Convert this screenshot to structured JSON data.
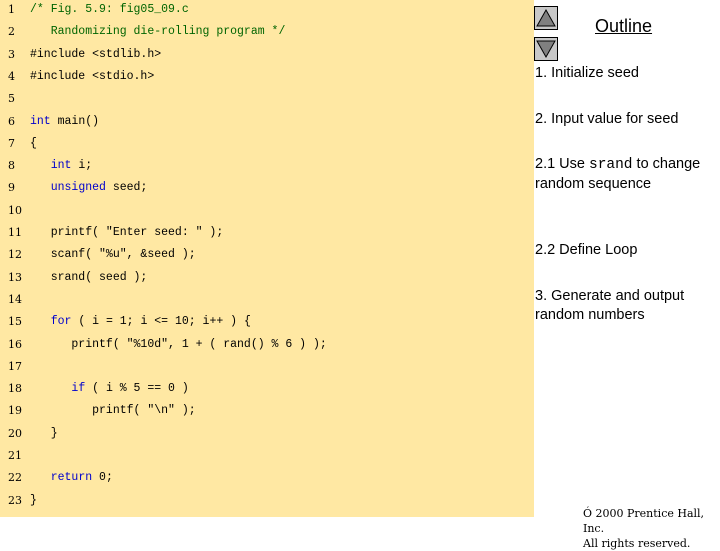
{
  "code_lines": [
    {
      "n": "1",
      "parts": [
        {
          "c": "cm",
          "t": "/* Fig. 5.9: fig05_09.c"
        }
      ]
    },
    {
      "n": "2",
      "parts": [
        {
          "c": "cm",
          "t": "   Randomizing die-rolling program */"
        }
      ]
    },
    {
      "n": "3",
      "parts": [
        {
          "c": "",
          "t": "#include <stdlib.h>"
        }
      ]
    },
    {
      "n": "4",
      "parts": [
        {
          "c": "",
          "t": "#include <stdio.h>"
        }
      ]
    },
    {
      "n": "5",
      "parts": []
    },
    {
      "n": "6",
      "parts": [
        {
          "c": "kw",
          "t": "int"
        },
        {
          "c": "",
          "t": " main()"
        }
      ]
    },
    {
      "n": "7",
      "parts": [
        {
          "c": "",
          "t": "{"
        }
      ]
    },
    {
      "n": "8",
      "parts": [
        {
          "c": "",
          "t": "   "
        },
        {
          "c": "kw",
          "t": "int"
        },
        {
          "c": "",
          "t": " i;"
        }
      ]
    },
    {
      "n": "9",
      "parts": [
        {
          "c": "",
          "t": "   "
        },
        {
          "c": "kw",
          "t": "unsigned"
        },
        {
          "c": "",
          "t": " seed;"
        }
      ]
    },
    {
      "n": "10",
      "parts": []
    },
    {
      "n": "11",
      "parts": [
        {
          "c": "",
          "t": "   printf( \"Enter seed: \" );"
        }
      ]
    },
    {
      "n": "12",
      "parts": [
        {
          "c": "",
          "t": "   scanf( \"%u\", &seed );"
        }
      ]
    },
    {
      "n": "13",
      "parts": [
        {
          "c": "",
          "t": "   srand( seed );"
        }
      ]
    },
    {
      "n": "14",
      "parts": []
    },
    {
      "n": "15",
      "parts": [
        {
          "c": "",
          "t": "   "
        },
        {
          "c": "kw",
          "t": "for"
        },
        {
          "c": "",
          "t": " ( i = 1; i <= 10; i++ ) {"
        }
      ]
    },
    {
      "n": "16",
      "parts": [
        {
          "c": "",
          "t": "      printf( \"%10d\", 1 + ( rand() % 6 ) );"
        }
      ]
    },
    {
      "n": "17",
      "parts": []
    },
    {
      "n": "18",
      "parts": [
        {
          "c": "",
          "t": "      "
        },
        {
          "c": "kw",
          "t": "if"
        },
        {
          "c": "",
          "t": " ( i % 5 == 0 )"
        }
      ]
    },
    {
      "n": "19",
      "parts": [
        {
          "c": "",
          "t": "         printf( \"\\n\" );"
        }
      ]
    },
    {
      "n": "20",
      "parts": [
        {
          "c": "",
          "t": "   }"
        }
      ]
    },
    {
      "n": "21",
      "parts": []
    },
    {
      "n": "22",
      "parts": [
        {
          "c": "",
          "t": "   "
        },
        {
          "c": "kw",
          "t": "return"
        },
        {
          "c": "",
          "t": " 0;"
        }
      ]
    },
    {
      "n": "23",
      "parts": [
        {
          "c": "",
          "t": "}"
        }
      ]
    }
  ],
  "outline": {
    "title": "Outline"
  },
  "nav": {
    "up_icon": "triangle-up-icon",
    "down_icon": "triangle-down-icon"
  },
  "steps": {
    "s1": "1.  Initialize seed",
    "s2": "2.  Input value for seed",
    "s21_prefix": "2.1  Use ",
    "s21_code": "srand",
    "s21_suffix": " to change random sequence",
    "s22": "2.2  Define Loop",
    "s3": "3.  Generate and output random numbers"
  },
  "copyright": {
    "line1": "Ó 2000 Prentice Hall, Inc.",
    "line2": "All rights reserved."
  },
  "colors": {
    "panel": "#ffe8a3",
    "comment": "#006400",
    "keyword": "#0000cc"
  }
}
